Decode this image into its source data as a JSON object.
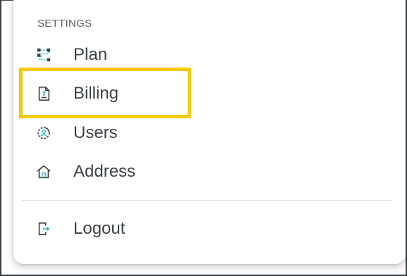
{
  "menu": {
    "section_heading": "SETTINGS",
    "items": [
      {
        "label": "Plan",
        "icon": "plan-icon"
      },
      {
        "label": "Billing",
        "icon": "billing-icon"
      },
      {
        "label": "Users",
        "icon": "users-icon"
      },
      {
        "label": "Address",
        "icon": "address-icon"
      }
    ],
    "logout": {
      "label": "Logout",
      "icon": "logout-icon"
    }
  },
  "colors": {
    "text": "#3d4247",
    "heading": "#5b6168",
    "icon_outline": "#3d4247",
    "icon_accent": "#2fb8c9",
    "highlight": "#f6c90e",
    "divider": "#dcdfe3"
  }
}
